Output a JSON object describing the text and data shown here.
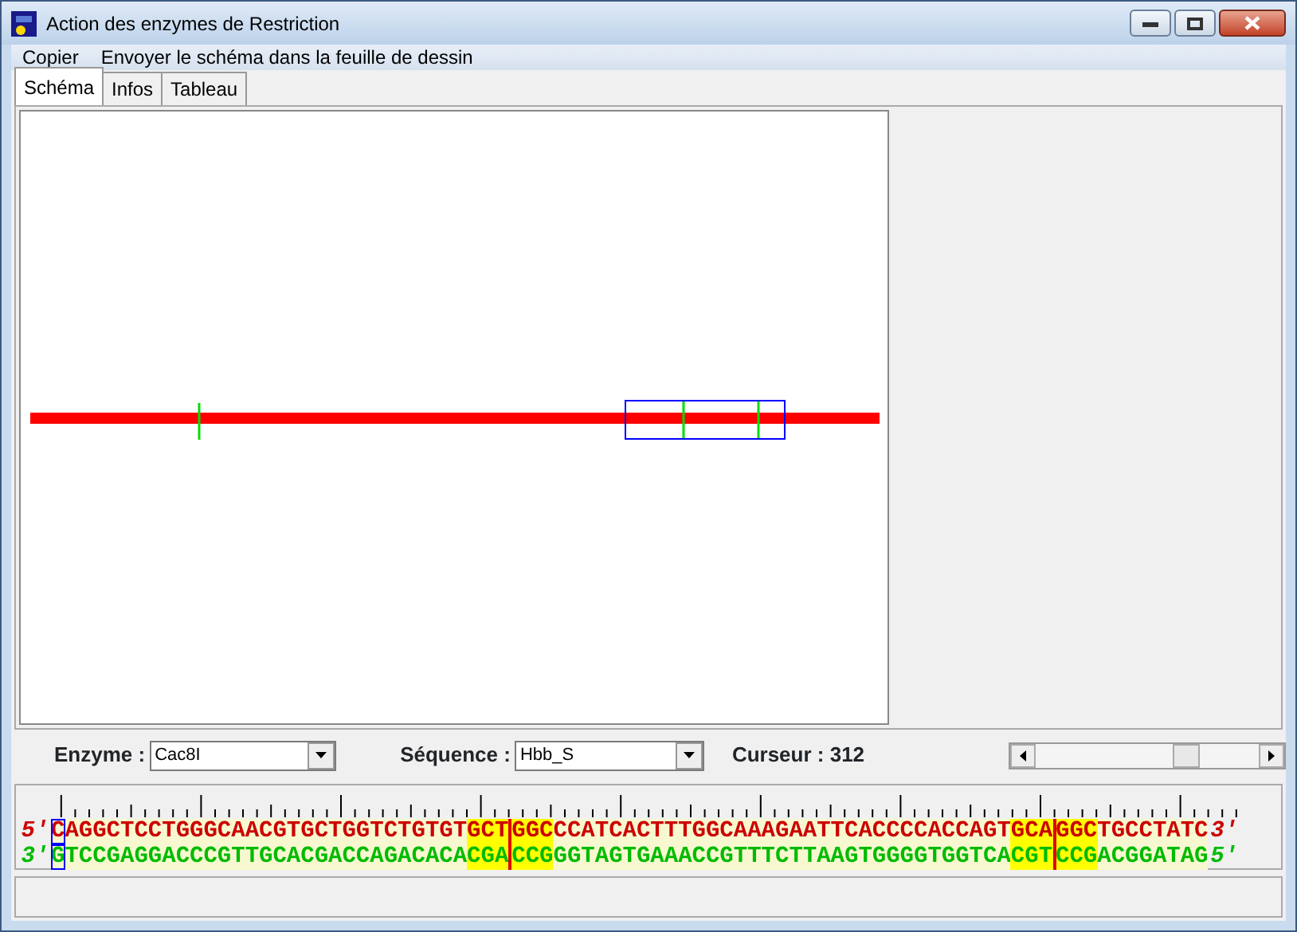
{
  "window": {
    "title": "Action des enzymes de Restriction"
  },
  "menu": [
    "Copier",
    "Envoyer le schéma dans la feuille de dessin"
  ],
  "tabs": [
    {
      "label": "Schéma",
      "selected": true
    },
    {
      "label": "Infos",
      "selected": false
    },
    {
      "label": "Tableau",
      "selected": false
    }
  ],
  "controls": {
    "enzyme_label": "Enzyme :",
    "enzyme_value": "Cac8I",
    "sequence_label": "Séquence :",
    "sequence_value": "Hbb_S",
    "cursor_label": "Curseur : 312"
  },
  "strands": [
    {
      "start_label": "5'",
      "end_label": "3'",
      "kind": "top",
      "segments": [
        {
          "text": "C",
          "cursor": true,
          "site": false,
          "cut": false
        },
        {
          "text": "AGGCTCCTGGGCAACGTGCTGGTCTGTGT",
          "cursor": false,
          "site": false,
          "cut": false
        },
        {
          "text": "GCT",
          "cursor": false,
          "site": true,
          "cut": false
        },
        {
          "text": "GGC",
          "cursor": false,
          "site": true,
          "cut": true
        },
        {
          "text": "CCATCACTTTGGCAAAGAATTCACCCCACCAGT",
          "cursor": false,
          "site": false,
          "cut": false
        },
        {
          "text": "GCA",
          "cursor": false,
          "site": true,
          "cut": false
        },
        {
          "text": "GGC",
          "cursor": false,
          "site": true,
          "cut": true
        },
        {
          "text": "TGCCTATC",
          "cursor": false,
          "site": false,
          "cut": false
        }
      ]
    },
    {
      "start_label": "3'",
      "end_label": "5'",
      "kind": "bottom",
      "segments": [
        {
          "text": "G",
          "cursor": true,
          "site": false,
          "cut": false
        },
        {
          "text": "TCCGAGGACCCGTTGCACGACCAGACACA",
          "cursor": false,
          "site": false,
          "cut": false
        },
        {
          "text": "CGA",
          "cursor": false,
          "site": true,
          "cut": false
        },
        {
          "text": "CCG",
          "cursor": false,
          "site": true,
          "cut": true
        },
        {
          "text": "GGTAGTGAAACCGTTTCTTAAGTGGGGTGGTCA",
          "cursor": false,
          "site": false,
          "cut": false
        },
        {
          "text": "CGT",
          "cursor": false,
          "site": true,
          "cut": false
        },
        {
          "text": "CCG",
          "cursor": false,
          "site": true,
          "cut": true
        },
        {
          "text": "ACGGATAG",
          "cursor": false,
          "site": false,
          "cut": false
        }
      ]
    }
  ]
}
